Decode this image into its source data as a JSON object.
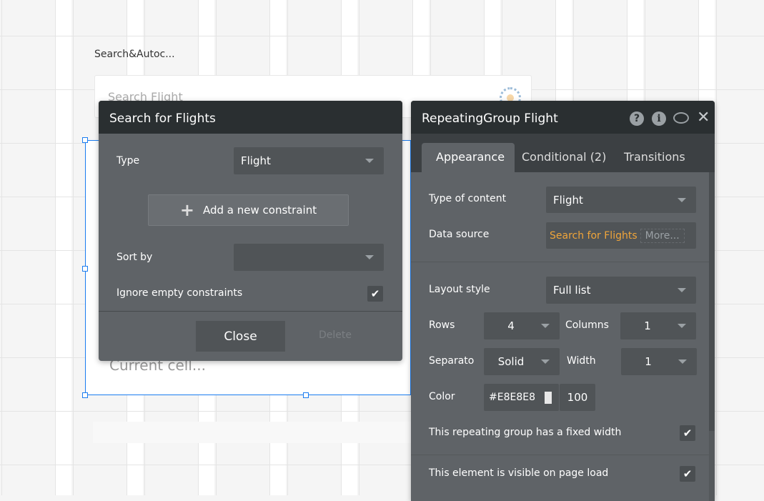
{
  "canvas": {
    "element_label": "Search&Autoc...",
    "search_placeholder": "Search Flight",
    "current_cell": "Current cell..."
  },
  "search_panel": {
    "title": "Search for Flights",
    "type_label": "Type",
    "type_value": "Flight",
    "add_constraint": "Add a new constraint",
    "sort_label": "Sort by",
    "sort_value": "",
    "ignore_label": "Ignore empty constraints",
    "ignore_checked": true,
    "close": "Close",
    "delete": "Delete"
  },
  "rg_panel": {
    "title": "RepeatingGroup Flight",
    "tabs": [
      {
        "label": "Appearance"
      },
      {
        "label": "Conditional (2)"
      },
      {
        "label": "Transitions"
      }
    ],
    "type_of_content_label": "Type of content",
    "type_of_content": "Flight",
    "data_source_label": "Data source",
    "data_source": "Search for Flights",
    "more": "More...",
    "layout_label": "Layout style",
    "layout": "Full list",
    "rows_label": "Rows",
    "rows": "4",
    "columns_label": "Columns",
    "columns": "1",
    "separator_label": "Separato",
    "separator": "Solid",
    "width_label": "Width",
    "width": "1",
    "color_label": "Color",
    "color": "#E8E8E8",
    "opacity": "100",
    "fixed_width_label": "This repeating group has a fixed width",
    "visible_label": "This element is visible on page load",
    "check": "✔"
  },
  "colors": {
    "accent": "#f0a53a",
    "selection": "#1a7cf0"
  }
}
